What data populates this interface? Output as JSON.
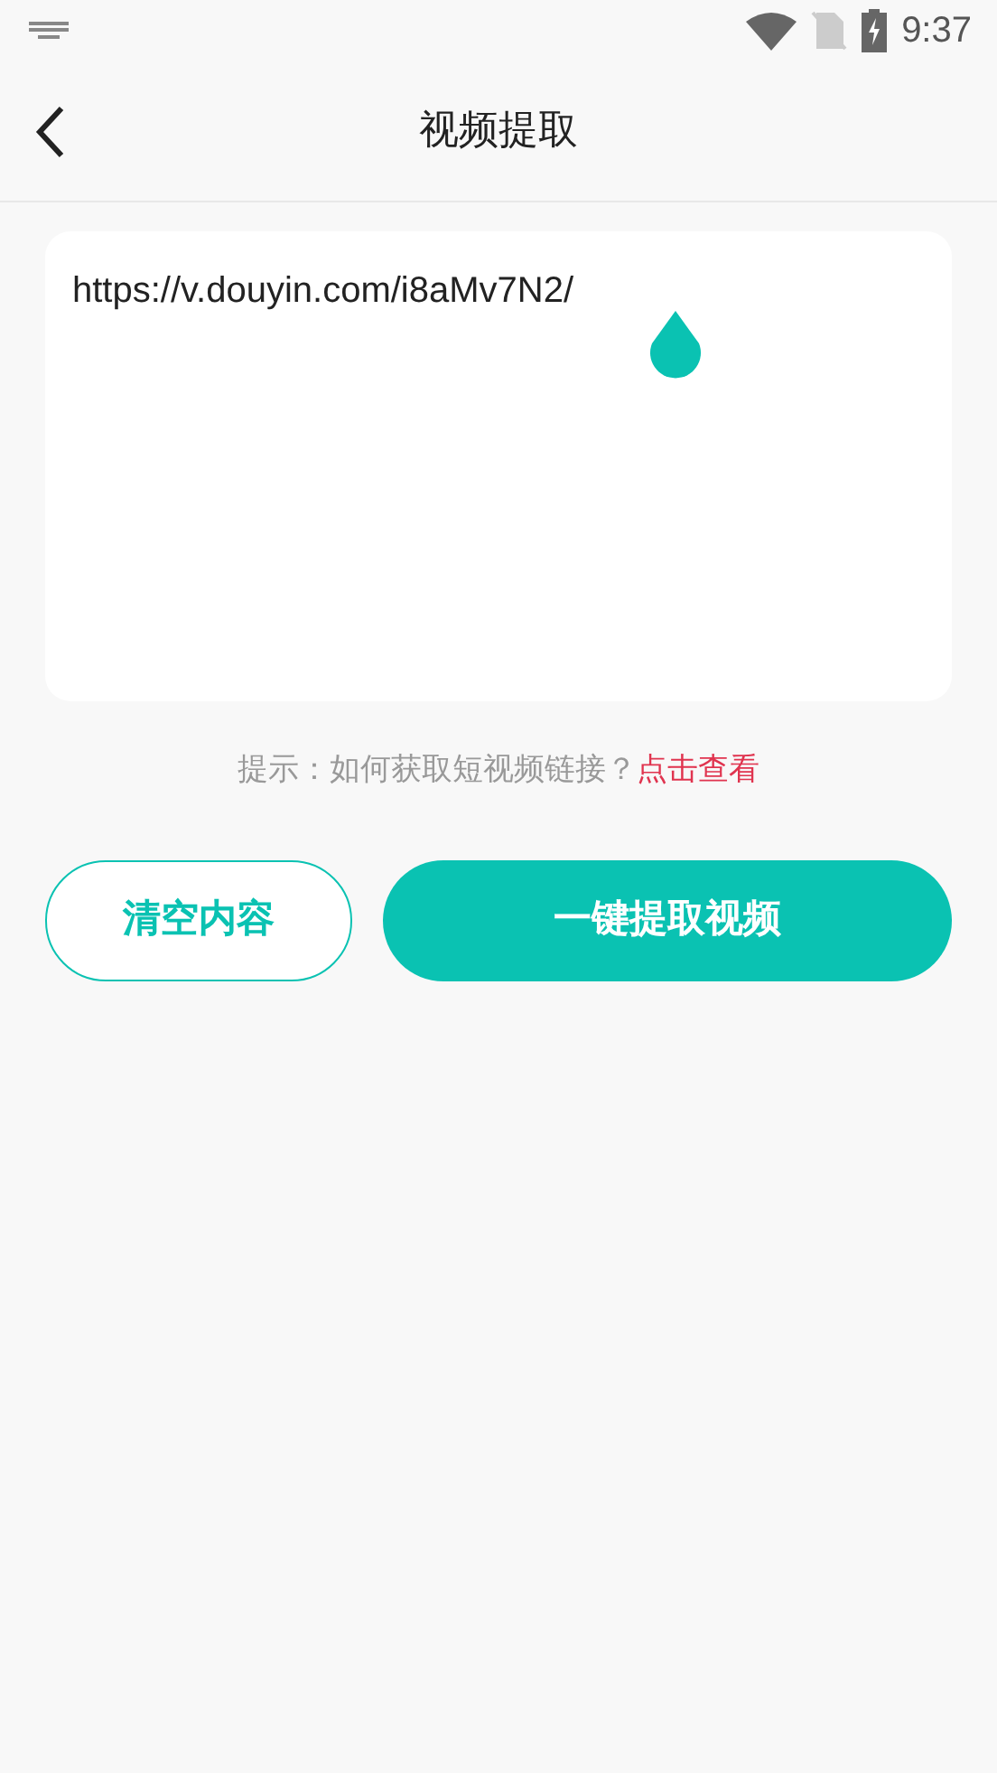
{
  "status_bar": {
    "time": "9:37"
  },
  "header": {
    "title": "视频提取"
  },
  "link_input": {
    "value": "https://v.douyin.com/i8aMv7N2/"
  },
  "hint": {
    "text": "提示：如何获取短视频链接？",
    "link": "点击查看"
  },
  "buttons": [
    {
      "label": "清空内容",
      "kind": "outline"
    },
    {
      "label": "一键提取视频",
      "kind": "primary"
    }
  ]
}
